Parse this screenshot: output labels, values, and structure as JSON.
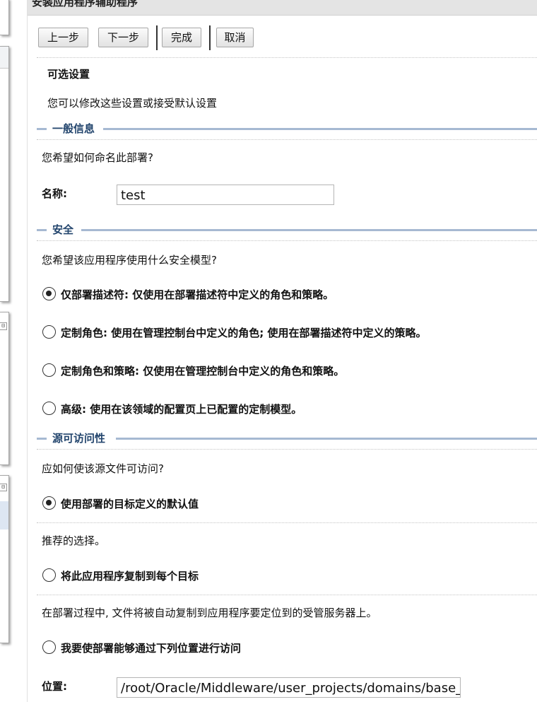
{
  "window": {
    "title": "安装应用程序辅助程序"
  },
  "toolbar": {
    "back_label": "上一步",
    "next_label": "下一步",
    "finish_label": "完成",
    "cancel_label": "取消"
  },
  "page": {
    "heading": "可选设置",
    "description": "您可以修改这些设置或接受默认设置"
  },
  "general": {
    "section_title": "一般信息",
    "question": "您希望如何命名此部署?",
    "name_label": "名称:",
    "name_value": "test"
  },
  "security": {
    "section_title": "安全",
    "question": "您希望该应用程序使用什么安全模型?",
    "options": [
      {
        "label": "仅部署描述符: 仅使用在部署描述符中定义的角色和策略。",
        "selected": true
      },
      {
        "label": "定制角色: 使用在管理控制台中定义的角色; 使用在部署描述符中定义的策略。",
        "selected": false
      },
      {
        "label": "定制角色和策略: 仅使用在管理控制台中定义的角色和策略。",
        "selected": false
      },
      {
        "label": "高级: 使用在该领域的配置页上已配置的定制模型。",
        "selected": false
      }
    ]
  },
  "source": {
    "section_title": "源可访问性",
    "question": "应如何使该源文件可访问?",
    "options": [
      {
        "label": "使用部署的目标定义的默认值",
        "selected": true,
        "note": "推荐的选择。"
      },
      {
        "label": "将此应用程序复制到每个目标",
        "selected": false,
        "note": "在部署过程中, 文件将被自动复制到应用程序要定位到的受管服务器上。"
      },
      {
        "label": "我要使部署能够通过下列位置进行访问",
        "selected": false
      }
    ],
    "location_label": "位置:",
    "location_value": "/root/Oracle/Middleware/user_projects/domains/base_domain/servers/AdminServer/upload"
  },
  "sidebar": {
    "collapse_glyph": "⊟"
  }
}
